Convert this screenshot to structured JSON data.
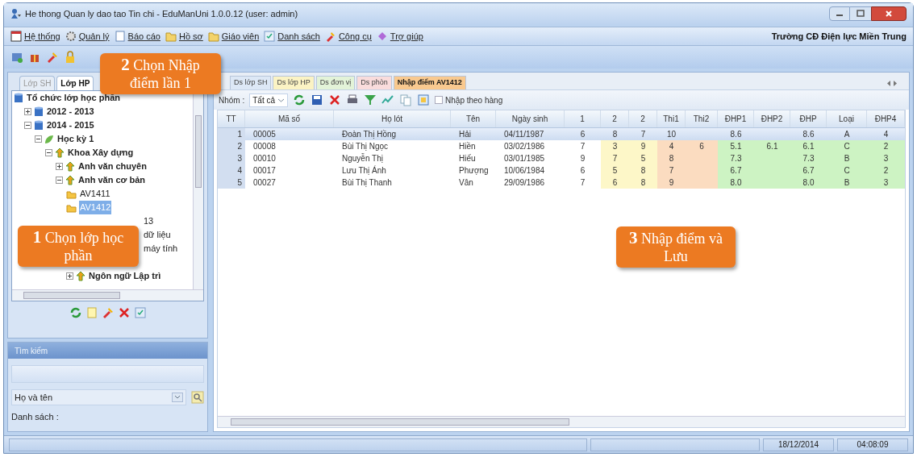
{
  "window": {
    "title": "He thong Quan ly dao tao Tin chi  - EduManUni 1.0.0.12 (user: admin)"
  },
  "menu": {
    "items": [
      {
        "label": "Hệ thống"
      },
      {
        "label": "Quản lý"
      },
      {
        "label": "Báo cáo"
      },
      {
        "label": "Hồ sơ"
      },
      {
        "label": "Giáo viên"
      },
      {
        "label": "Danh sách"
      },
      {
        "label": "Công cụ"
      },
      {
        "label": "Trợ giúp"
      }
    ],
    "school": "Trường CĐ Điện lực Miền Trung"
  },
  "left_panel": {
    "tabs": [
      {
        "label": "Lớp SH",
        "selected": false
      },
      {
        "label": "Lớp HP",
        "selected": true
      }
    ],
    "tree": [
      {
        "label": "Tổ chức lớp học phần",
        "kind": "group",
        "children": [
          {
            "label": "2012 - 2013",
            "kind": "group",
            "expanded": false
          },
          {
            "label": "2014 - 2015",
            "kind": "group",
            "expanded": true,
            "children": [
              {
                "label": "Học kỳ 1",
                "kind": "term",
                "expanded": true,
                "children": [
                  {
                    "label": "Khoa Xây dựng",
                    "kind": "dept",
                    "expanded": true,
                    "children": [
                      {
                        "label": "Anh văn chuyên",
                        "kind": "dept",
                        "expanded": false
                      },
                      {
                        "label": "Anh văn cơ bản",
                        "kind": "dept",
                        "expanded": true,
                        "children": [
                          {
                            "label": "AV1411",
                            "kind": "class",
                            "selected": false
                          },
                          {
                            "label": "AV1412",
                            "kind": "class",
                            "selected": true
                          },
                          {
                            "label": "13",
                            "kind": "fragment"
                          },
                          {
                            "label": "dữ liệu",
                            "kind": "fragment"
                          },
                          {
                            "label": "máy tính",
                            "kind": "fragment"
                          },
                          {
                            "kind": "hidden"
                          },
                          {
                            "label": "Ngôn ngữ Lập trì",
                            "kind": "dept",
                            "expanded": false
                          }
                        ]
                      }
                    ]
                  }
                ]
              }
            ]
          }
        ]
      }
    ],
    "search": {
      "title": "Tìm kiếm",
      "field_by": "Họ và tên",
      "list_label": "Danh sách :"
    }
  },
  "right_panel": {
    "tabs": [
      {
        "label": "Ds lớp SH",
        "selected": false,
        "color": "#dde8f6"
      },
      {
        "label": "Ds lớp HP",
        "selected": false,
        "color": "#fbf3c4"
      },
      {
        "label": "Ds đơn vị",
        "selected": false,
        "color": "#e3f3d8"
      },
      {
        "label": "Ds phòn",
        "selected": false,
        "color": "#f9dcdc"
      },
      {
        "label": "Nhập điểm AV1412",
        "selected": true,
        "color": "#f9c98f"
      }
    ],
    "group_label": "Nhóm :",
    "group_value": "Tất cả",
    "by_row": {
      "label": "Nhập theo hàng",
      "checked": false
    },
    "columns": [
      {
        "label": "TT",
        "kind": "index"
      },
      {
        "label": "Mã số",
        "kind": "text"
      },
      {
        "label": "Họ lót",
        "kind": "text"
      },
      {
        "label": "Tên",
        "kind": "text"
      },
      {
        "label": "Ngày sinh",
        "kind": "text"
      },
      {
        "label": "1",
        "kind": "score"
      },
      {
        "label": "2",
        "kind": "mid"
      },
      {
        "label": "2",
        "kind": "mid"
      },
      {
        "label": "Thi1",
        "kind": "exam"
      },
      {
        "label": "Thi2",
        "kind": "exam"
      },
      {
        "label": "ĐHP1",
        "kind": "result"
      },
      {
        "label": "ĐHP2",
        "kind": "result"
      },
      {
        "label": "ĐHP",
        "kind": "result"
      },
      {
        "label": "Loại",
        "kind": "result"
      },
      {
        "label": "ĐHP4",
        "kind": "result"
      }
    ],
    "rows": [
      {
        "selected": true,
        "cells": [
          "1",
          "00005",
          "Đoàn Thị Hồng",
          "Hải",
          "04/11/1987",
          "6",
          "8",
          "7",
          "10",
          null,
          "8.6",
          null,
          "8.6",
          "A",
          "4"
        ]
      },
      {
        "selected": false,
        "cells": [
          "2",
          "00008",
          "Bùi Thị Ngọc",
          "Hiền",
          "03/02/1986",
          "7",
          "3",
          "9",
          "4",
          "6",
          "5.1",
          "6.1",
          "6.1",
          "C",
          "2"
        ]
      },
      {
        "selected": false,
        "cells": [
          "3",
          "00010",
          "Nguyễn Thị",
          "Hiếu",
          "03/01/1985",
          "9",
          "7",
          "5",
          "8",
          null,
          "7.3",
          null,
          "7.3",
          "B",
          "3"
        ]
      },
      {
        "selected": false,
        "cells": [
          "4",
          "00017",
          "Lưu Thị Ánh",
          "Phượng",
          "10/06/1984",
          "6",
          "5",
          "8",
          "7",
          null,
          "6.7",
          null,
          "6.7",
          "C",
          "2"
        ]
      },
      {
        "selected": false,
        "cells": [
          "5",
          "00027",
          "Bùi Thị Thanh",
          "Vân",
          "29/09/1986",
          "7",
          "6",
          "8",
          "9",
          null,
          "8.0",
          null,
          "8.0",
          "B",
          "3"
        ]
      }
    ]
  },
  "callouts": [
    {
      "number": "2",
      "text": "Chọn Nhập điểm lần 1"
    },
    {
      "number": "1",
      "text": "Chọn lớp học phần"
    },
    {
      "number": "3",
      "text": "Nhập điểm và Lưu"
    }
  ],
  "status_bar": {
    "date": "18/12/2014",
    "time": "04:08:09"
  }
}
